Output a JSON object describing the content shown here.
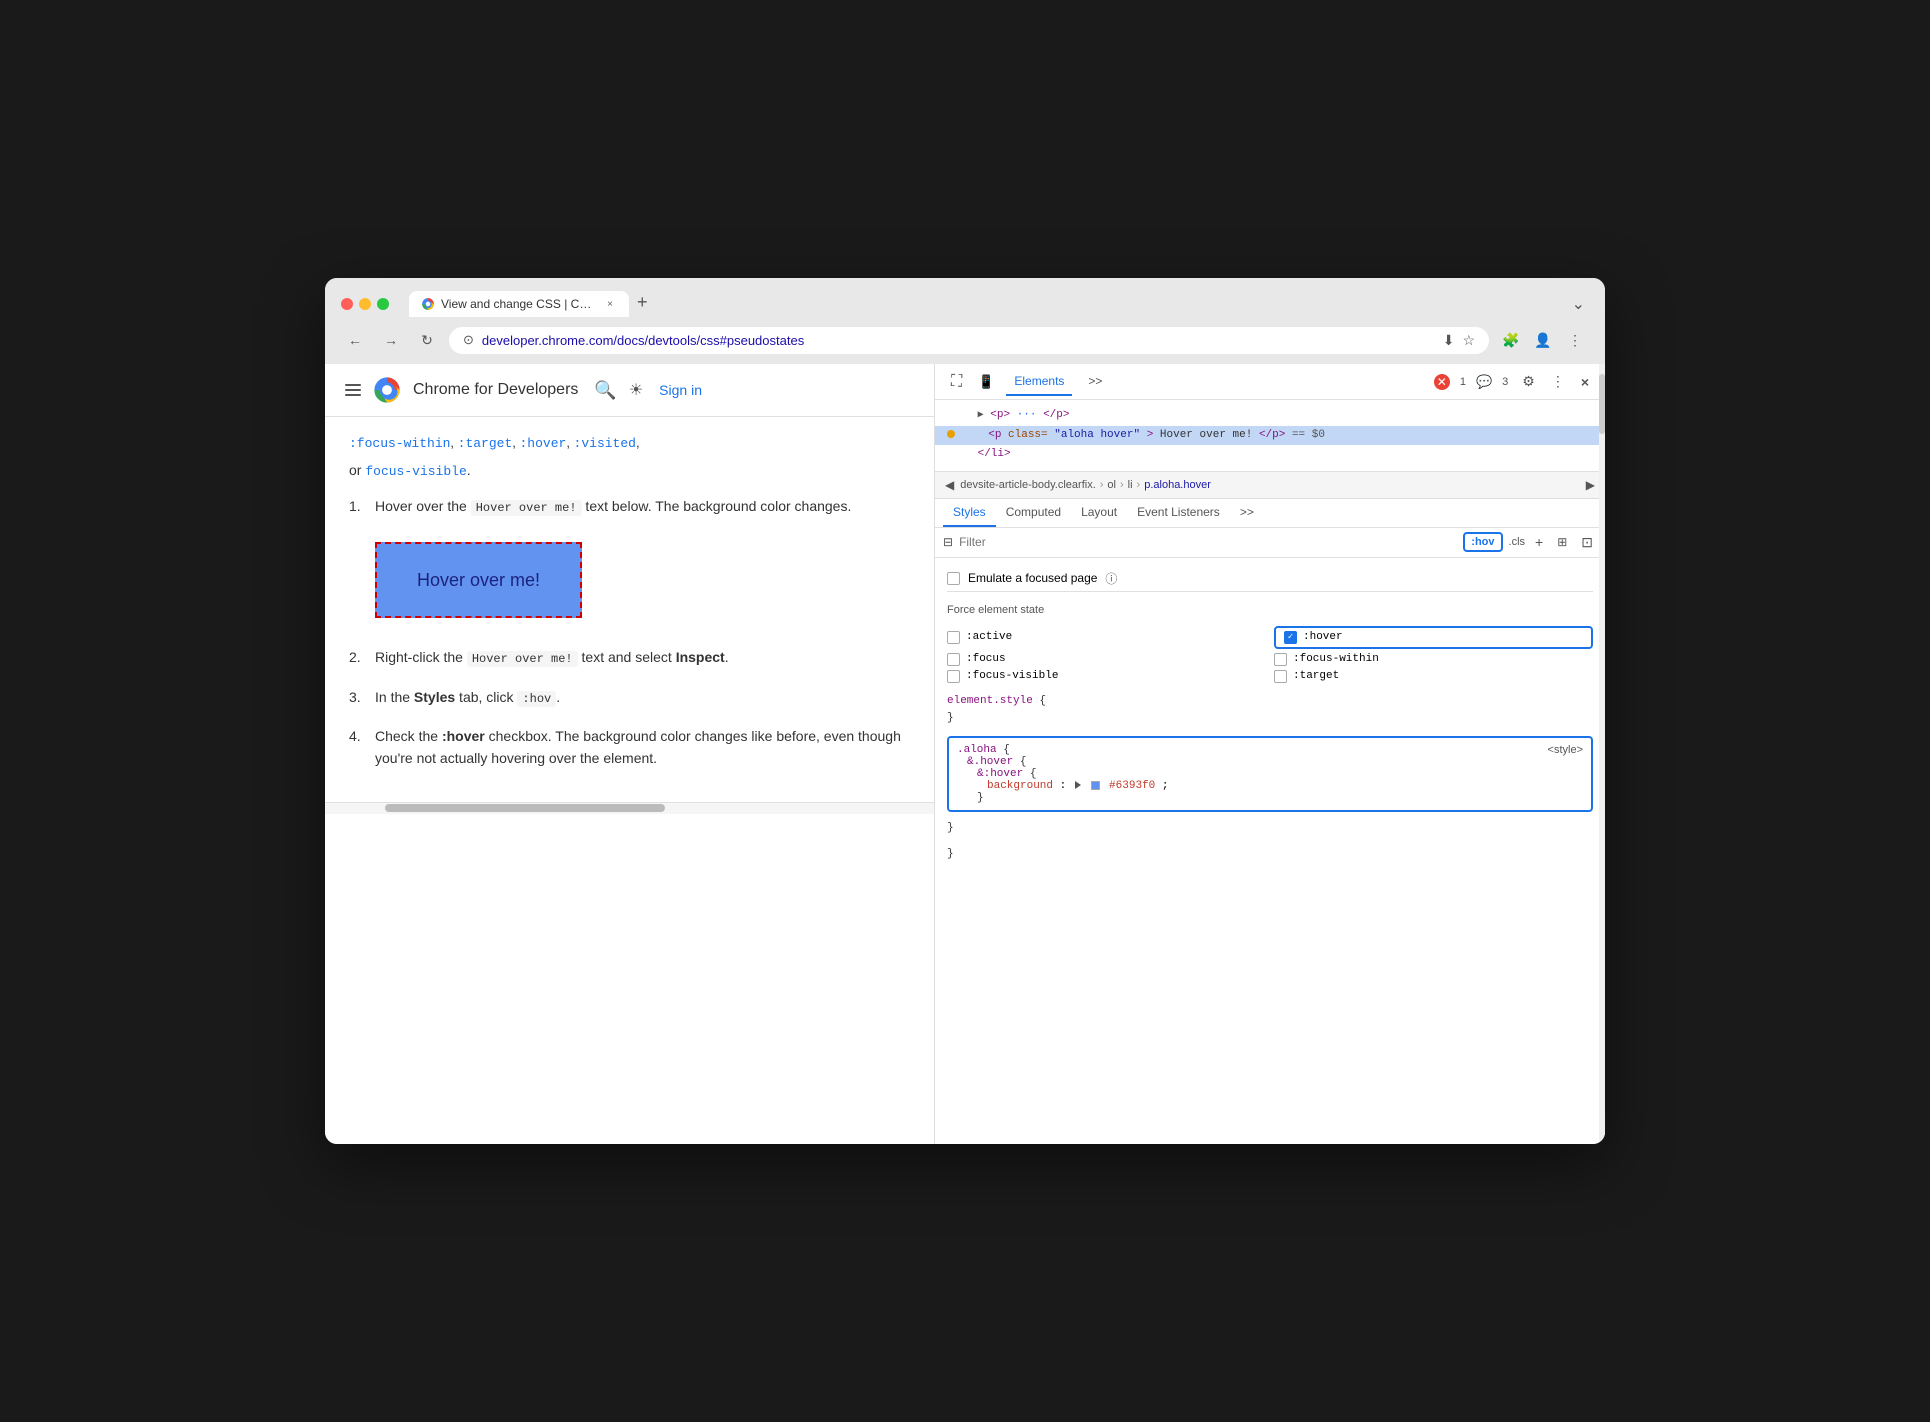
{
  "browser": {
    "traffic_lights": [
      "red",
      "yellow",
      "green"
    ],
    "tab_title": "View and change CSS | Chr...",
    "tab_close": "×",
    "new_tab": "+",
    "tab_dropdown": "⌄",
    "back_btn": "←",
    "forward_btn": "→",
    "reload_btn": "↻",
    "url": "developer.chrome.com/docs/devtools/css#pseudostates",
    "download_icon": "⬇",
    "bookmark_icon": "☆",
    "extensions_icon": "🧩",
    "profile_icon": "👤",
    "more_icon": "⋮"
  },
  "header": {
    "hamburger_label": "Menu",
    "site_name": "Chrome for Developers",
    "search_icon": "🔍",
    "theme_icon": "☀",
    "sign_in": "Sign in"
  },
  "article": {
    "breadcrumb_text": ":focus-within, :target, :visited,",
    "or_text": "or",
    "focus_visible": "focus-visible",
    "period": ".",
    "steps": [
      {
        "num": "1.",
        "text_before": "Hover over the",
        "code": "Hover over me!",
        "text_after": "text below. The background color changes."
      },
      {
        "num": "2.",
        "text_before": "Right-click the",
        "code": "Hover over me!",
        "text_after": "text and select",
        "bold": "Inspect",
        "period": "."
      },
      {
        "num": "3.",
        "text_before": "In the",
        "bold_styles": "Styles",
        "text_middle": "tab, click",
        "code_hov": ":hov",
        "period": "."
      },
      {
        "num": "4.",
        "text_before": "Check the",
        "bold_hover": ":hover",
        "text_after": "checkbox. The background color changes like before, even though you're not actually hovering over the element."
      }
    ],
    "hover_box_label": "Hover over me!"
  },
  "devtools": {
    "top_icons": [
      "cursor-select",
      "device-toggle"
    ],
    "tabs": [
      "Elements",
      ">>"
    ],
    "error_count": "1",
    "warning_count": "3",
    "settings_icon": "⚙",
    "more_icon": "⋮",
    "close_icon": "×",
    "dom": {
      "rows": [
        {
          "content": "▶ <p> ··· </p>",
          "indent": 1,
          "selected": false
        },
        {
          "content": "<p class=\"aloha hover\">Hover over me!</p> == $0",
          "indent": 2,
          "selected": true
        },
        {
          "content": "</li>",
          "indent": 1,
          "selected": false
        }
      ]
    },
    "breadcrumb": {
      "items": [
        "devsite-article-body.clearfix.",
        "ol",
        "li",
        "p.aloha.hover"
      ]
    },
    "styles_tabs": [
      "Styles",
      "Computed",
      "Layout",
      "Event Listeners",
      ">>"
    ],
    "filter": {
      "placeholder": "Filter",
      "hov_btn": ":hov",
      "cls_btn": ".cls"
    },
    "emulate_label": "Emulate a focused page",
    "force_state_label": "Force element state",
    "states": {
      "left": [
        ":active",
        ":focus",
        ":focus-visible"
      ],
      "right": [
        ":hover",
        ":focus-within",
        ":target"
      ]
    },
    "hover_checked": true,
    "css_rules": [
      {
        "selector": "element.style {",
        "close": "}",
        "props": []
      }
    ],
    "highlighted_rule": {
      "lines": [
        ".aloha {",
        "  &.hover {",
        "    &:hover {",
        "      background: #6393f0;",
        "    }",
        "  }",
        "}"
      ],
      "source": "<style>"
    }
  },
  "colors": {
    "hover_box_bg": "#6393f0",
    "hover_box_border": "#cc0000",
    "active_tab_color": "#1a73e8",
    "link_color": "#1a73e8",
    "error_badge_bg": "#ea4335",
    "swatch_color": "#6393f0"
  }
}
